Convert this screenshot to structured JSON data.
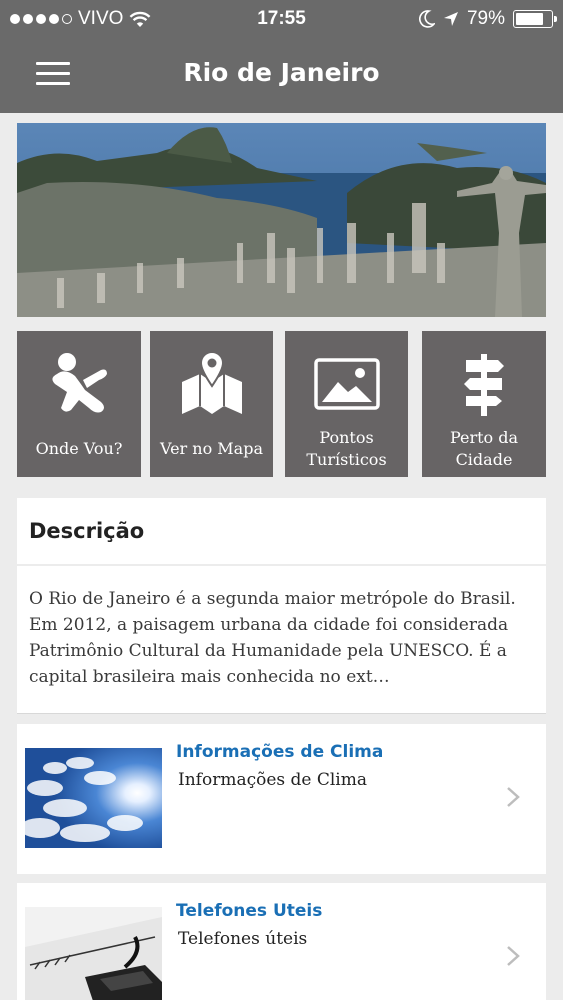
{
  "status_bar": {
    "carrier": "VIVO",
    "time": "17:55",
    "battery": "79%",
    "battery_level": 0.79,
    "icons": [
      "signal-dots-icon",
      "wifi-icon",
      "moon-icon",
      "location-arrow-icon",
      "battery-icon"
    ]
  },
  "nav": {
    "title": "Rio de Janeiro",
    "menu_icon": "hamburger-menu-icon"
  },
  "colors": {
    "bar": "#6a6a6a",
    "tile": "#676465",
    "link": "#1a6fb5",
    "background": "#ececec"
  },
  "tiles": [
    {
      "label": "Onde Vou?",
      "icon": "person-jump-icon"
    },
    {
      "label": "Ver no Mapa",
      "icon": "map-pin-icon"
    },
    {
      "label": "Pontos Turísticos",
      "icon": "picture-icon"
    },
    {
      "label": "Perto da Cidade",
      "icon": "signpost-icon"
    }
  ],
  "description": {
    "heading": "Descrição",
    "text": "O Rio de Janeiro é a segunda maior metrópole do Brasil. Em 2012, a paisagem urbana da cidade foi considerada Patrimônio Cultural da Humanidade pela UNESCO. É a capital brasileira mais conhecida no ext…"
  },
  "list": [
    {
      "title": "Informações de Clima",
      "subtitle": "Informações de Clima",
      "thumb": "sky-sun-photo"
    },
    {
      "title": "Telefones Uteis",
      "subtitle": "Telefones úteis",
      "thumb": "telephone-photo"
    }
  ]
}
